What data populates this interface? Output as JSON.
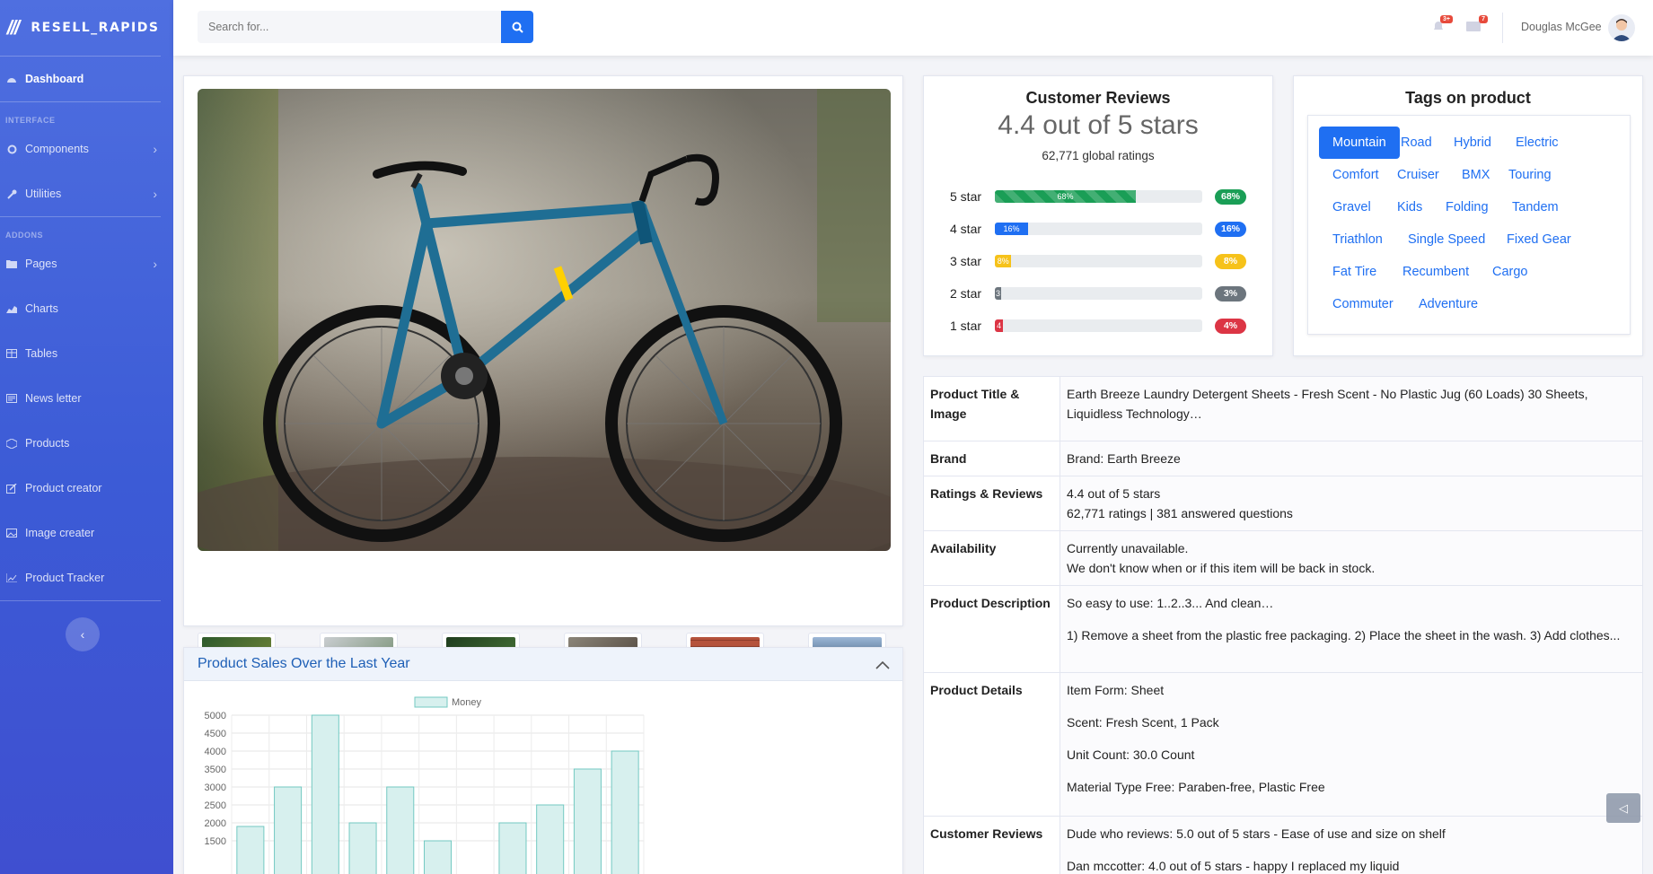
{
  "brand": {
    "name": "RESELL_RAPIDS"
  },
  "sidebar": {
    "dashboard": "Dashboard",
    "heading_interface": "INTERFACE",
    "components": "Components",
    "utilities": "Utilities",
    "heading_addons": "ADDONS",
    "pages": "Pages",
    "charts": "Charts",
    "tables": "Tables",
    "newsletter": "News letter",
    "products": "Products",
    "product_creator": "Product creator",
    "image_creater": "Image creater",
    "product_tracker": "Product Tracker"
  },
  "topbar": {
    "search_placeholder": "Search for...",
    "alerts_badge": "3+",
    "messages_badge": "7",
    "user_name": "Douglas McGee"
  },
  "reviews": {
    "title": "Customer Reviews",
    "score": "4.4 out of 5 stars",
    "global": "62,771 global ratings",
    "rows": [
      {
        "label": "5 star",
        "bar_text": "68%",
        "pill": "68%",
        "percent": 68,
        "color": "#1a9e56"
      },
      {
        "label": "4 star",
        "bar_text": "16%",
        "pill": "16%",
        "percent": 16,
        "color": "#1f6ff2"
      },
      {
        "label": "3 star",
        "bar_text": "8%",
        "pill": "8%",
        "percent": 8,
        "color": "#f6c21a"
      },
      {
        "label": "2 star",
        "bar_text": "3",
        "pill": "3%",
        "percent": 3,
        "color": "#6c757d"
      },
      {
        "label": "1 star",
        "bar_text": "4",
        "pill": "4%",
        "percent": 4,
        "color": "#dc3545"
      }
    ]
  },
  "tags": {
    "title": "Tags on product",
    "items": [
      "Mountain",
      "Road",
      "Hybrid",
      "Electric",
      "Comfort",
      "Cruiser",
      "BMX",
      "Touring",
      "Gravel",
      "Kids",
      "Folding",
      "Tandem",
      "Triathlon",
      "Single Speed",
      "Fixed Gear",
      "Fat Tire",
      "Recumbent",
      "Cargo",
      "Commuter",
      "Adventure"
    ]
  },
  "details": {
    "title_key": "Product Title & Image",
    "title_val": "Earth Breeze Laundry Detergent Sheets - Fresh Scent - No Plastic Jug (60 Loads) 30 Sheets, Liquidless Technology…",
    "brand_key": "Brand",
    "brand_val": "Brand: Earth Breeze",
    "ratings_key": "Ratings & Reviews",
    "ratings_val1": "4.4 out of 5 stars",
    "ratings_val2": "62,771 ratings | 381 answered questions",
    "avail_key": "Availability",
    "avail_val1": "Currently unavailable.",
    "avail_val2": "We don't know when or if this item will be back in stock.",
    "desc_key": "Product Description",
    "desc_val1": "So easy to use: 1..2..3... And clean…",
    "desc_val2": "1) Remove a sheet from the plastic free packaging. 2) Place the sheet in the wash. 3) Add clothes...",
    "pd_key": "Product Details",
    "pd_val1": "Item Form: Sheet",
    "pd_val2": "Scent: Fresh Scent, 1 Pack",
    "pd_val3": "Unit Count: 30.0 Count",
    "pd_val4": "Material Type Free: Paraben-free, Plastic Free",
    "cr_key": "Customer Reviews",
    "cr_val1": "Dude who reviews: 5.0 out of 5 stars - Ease of use and size on shelf",
    "cr_val2": "Dan mccotter: 4.0 out of 5 stars - happy I replaced my liquid"
  },
  "thumbnails": [
    "orange-gravel-bike",
    "teal-city-bike",
    "green-trail-bike",
    "blue-bike-rocks",
    "red-bike-brick-wall",
    "blue-bike-mountains"
  ],
  "sales_chart": {
    "header": "Product Sales Over the Last Year"
  },
  "chart_data": {
    "type": "bar",
    "title": "",
    "legend": [
      "Money"
    ],
    "y_ticks": [
      "5000",
      "4500",
      "4000",
      "3500",
      "3000",
      "2500",
      "2000",
      "1500"
    ],
    "series": [
      {
        "name": "Money",
        "values": [
          1900,
          3000,
          5000,
          2000,
          3000,
          1500,
          null,
          2000,
          2500,
          3500,
          4000
        ]
      }
    ],
    "ylim_visible": [
      1500,
      5000
    ],
    "colors": {
      "fill": "#d7f0ee",
      "stroke": "#73c9c2"
    }
  }
}
